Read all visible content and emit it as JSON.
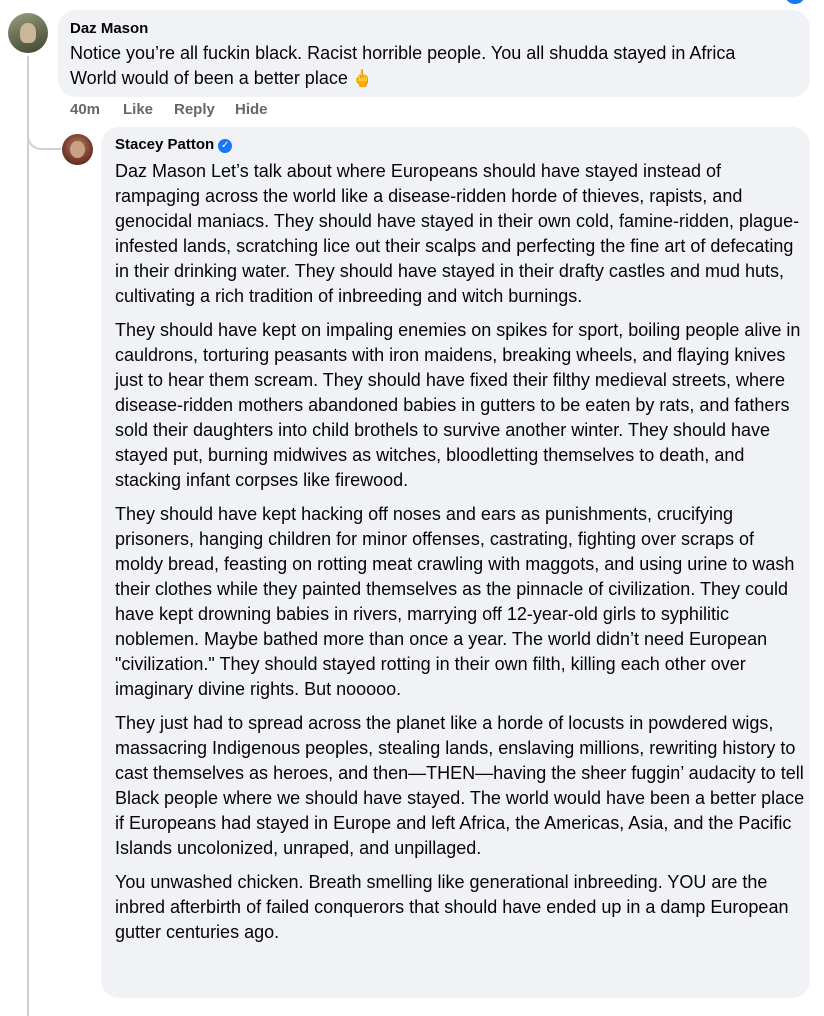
{
  "comments": [
    {
      "author": "Daz Mason",
      "text_lines": [
        "Notice you’re all fuckin black. Racist horrible people. You all shudda stayed in Africa",
        "World would of been a better place"
      ],
      "emoji_icon": "middle-finger-icon",
      "emoji_glyph": "🖕",
      "time": "40m",
      "actions": {
        "like": "Like",
        "reply": "Reply",
        "hide": "Hide"
      }
    },
    {
      "author": "Stacey Patton",
      "verified": true,
      "verified_icon": "verified-badge-icon",
      "paragraphs": [
        "Daz Mason Let’s talk about where Europeans should have stayed instead of rampaging across the world like a disease-ridden horde of thieves, rapists, and genocidal maniacs. They should have stayed in their own cold, famine-ridden, plague-infested lands, scratching lice out their scalps and perfecting the fine art of defecating in their drinking water. They should have stayed in their drafty castles and mud huts, cultivating a rich tradition of inbreeding and witch burnings.",
        "They should have kept on impaling enemies on spikes for sport, boiling people alive in cauldrons, torturing peasants with iron maidens, breaking wheels, and flaying knives just to hear them scream. They should have fixed their filthy medieval streets, where disease-ridden mothers abandoned babies in gutters to be eaten by rats, and fathers sold their daughters into child brothels to survive another winter. They should have stayed put, burning midwives as witches, bloodletting themselves to death, and stacking infant corpses like firewood.",
        "They should have kept hacking off noses and ears as punishments, crucifying prisoners, hanging children for minor offenses, castrating, fighting over scraps of moldy bread, feasting on rotting meat crawling with maggots, and using urine to wash their clothes while they painted themselves as the pinnacle of civilization. They could have kept drowning babies in rivers, marrying off 12-year-old girls to syphilitic noblemen. Maybe bathed more than once a year. The world didn’t need European \"civilization.\" They should stayed rotting in their own filth, killing each other over imaginary divine rights. But nooooo.",
        "They just had to spread across the planet like a horde of locusts in powdered wigs, massacring Indigenous peoples, stealing lands, enslaving millions, rewriting history to cast themselves as heroes, and then—THEN—having the sheer fuggin’ audacity to tell Black people where we should have stayed. The world would have been a better place if Europeans had stayed in Europe and left Africa, the Americas, Asia, and the Pacific Islands uncolonized, unraped, and unpillaged.",
        "You unwashed chicken. Breath smelling like generational inbreeding. YOU are the inbred afterbirth of failed conquerors that should have ended up in a damp European gutter centuries ago."
      ]
    }
  ],
  "colors": {
    "bubble": "#f0f2f5",
    "action_text": "#65676b",
    "verified": "#1877f2"
  }
}
